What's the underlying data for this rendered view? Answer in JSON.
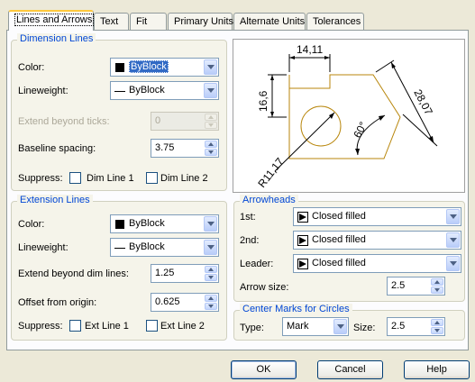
{
  "tabs": [
    {
      "label": "Lines and Arrows",
      "active": true
    },
    {
      "label": "Text"
    },
    {
      "label": "Fit"
    },
    {
      "label": "Primary Units"
    },
    {
      "label": "Alternate Units"
    },
    {
      "label": "Tolerances"
    }
  ],
  "dimension_lines": {
    "title": "Dimension Lines",
    "color_label": "Color:",
    "color_value": "ByBlock",
    "lineweight_label": "Lineweight:",
    "lineweight_value": "ByBlock",
    "extend_label": "Extend beyond ticks:",
    "extend_value": "0",
    "baseline_label": "Baseline spacing:",
    "baseline_value": "3.75",
    "suppress_label": "Suppress:",
    "dim1_label": "Dim Line 1",
    "dim2_label": "Dim Line 2"
  },
  "extension_lines": {
    "title": "Extension Lines",
    "color_label": "Color:",
    "color_value": "ByBlock",
    "lineweight_label": "Lineweight:",
    "lineweight_value": "ByBlock",
    "extend_label": "Extend beyond dim lines:",
    "extend_value": "1.25",
    "offset_label": "Offset from origin:",
    "offset_value": "0.625",
    "suppress_label": "Suppress:",
    "ext1_label": "Ext Line 1",
    "ext2_label": "Ext Line 2"
  },
  "preview": {
    "dim_top": "14,11",
    "dim_left": "16,6",
    "dim_right": "28,07",
    "dim_angle": "60°",
    "dim_radius": "R11,17"
  },
  "arrowheads": {
    "title": "Arrowheads",
    "first_label": "1st:",
    "first_value": "Closed filled",
    "second_label": "2nd:",
    "second_value": "Closed filled",
    "leader_label": "Leader:",
    "leader_value": "Closed filled",
    "size_label": "Arrow size:",
    "size_value": "2.5"
  },
  "center_marks": {
    "title": "Center Marks for Circles",
    "type_label": "Type:",
    "type_value": "Mark",
    "size_label": "Size:",
    "size_value": "2.5"
  },
  "buttons": {
    "ok": "OK",
    "cancel": "Cancel",
    "help": "Help"
  },
  "colors": {
    "accent": "#0046D5",
    "preview_shape": "#B8860B",
    "selection": "#316AC5"
  }
}
